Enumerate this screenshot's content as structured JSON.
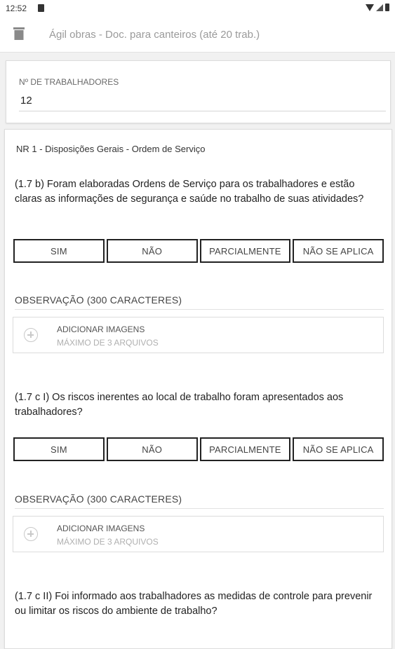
{
  "status_bar": {
    "time": "12:52",
    "icons": [
      "sim-card-icon",
      "wifi-icon",
      "signal-icon",
      "battery-icon"
    ]
  },
  "app_bar": {
    "title": "Ágil obras - Doc. para canteiros (até 20 trab.)",
    "icon": "trash-icon"
  },
  "workers": {
    "label": "Nº DE TRABALHADORES",
    "value": "12"
  },
  "form": {
    "section_title": "NR 1 - Disposições Gerais - Ordem de Serviço",
    "option_labels": [
      "SIM",
      "NÃO",
      "PARCIALMENTE",
      "NÃO SE APLICA"
    ],
    "observation_label": "OBSERVAÇÃO (300 CARACTERES)",
    "add_images_label": "ADICIONAR IMAGENS",
    "add_images_sub": "MÁXIMO DE 3 ARQUIVOS",
    "questions": [
      {
        "text": "(1.7 b) Foram elaboradas Ordens de Serviço para os trabalhadores e estão claras as informações de segurança e saúde no trabalho de suas atividades?"
      },
      {
        "text": "(1.7 c I) Os riscos inerentes ao local de trabalho foram apresentados aos trabalhadores?"
      },
      {
        "text": "(1.7 c II) Foi informado aos trabalhadores as medidas de controle para prevenir ou limitar os riscos do ambiente de trabalho?"
      }
    ]
  },
  "colors": {
    "background": "#f1f1f1",
    "card": "#ffffff",
    "option_border": "#222222",
    "muted_text": "#9a9a9a"
  }
}
